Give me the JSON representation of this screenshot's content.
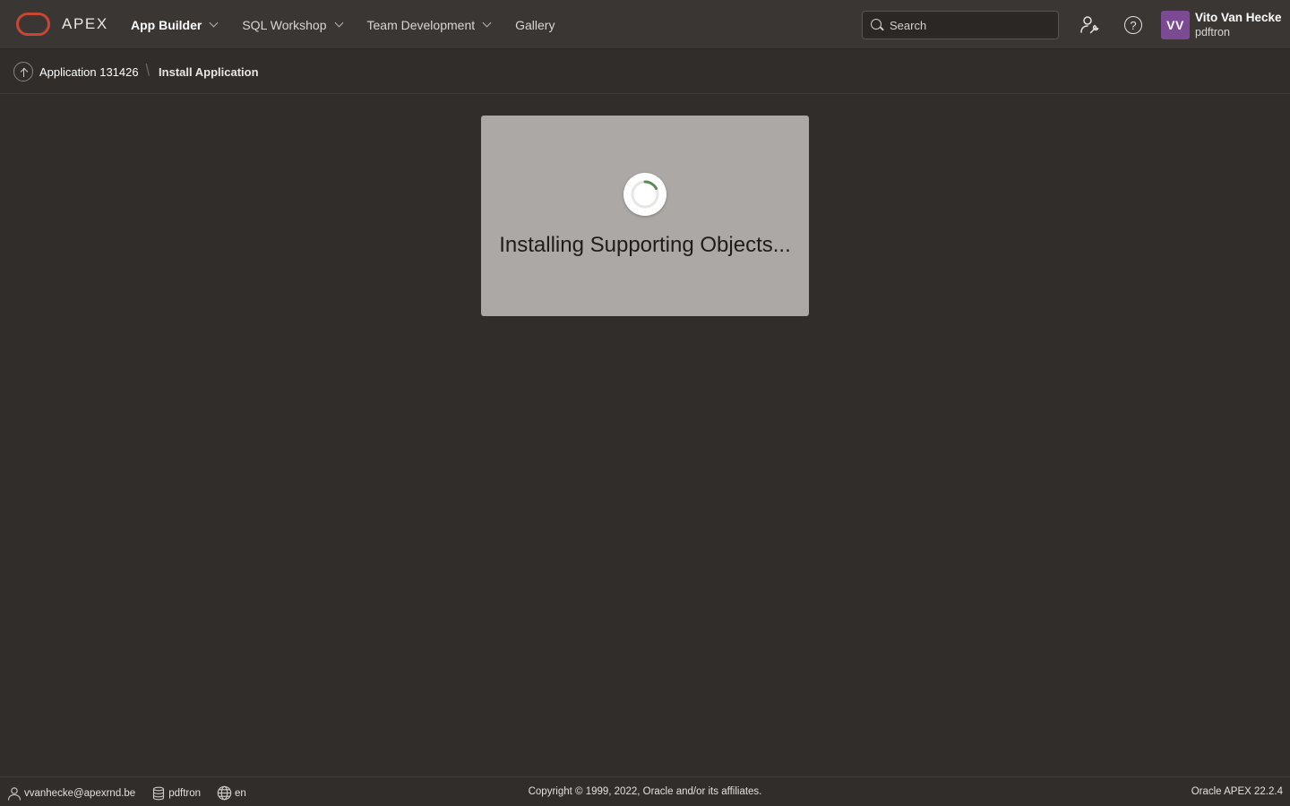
{
  "header": {
    "logo_text": "APEX",
    "nav": [
      {
        "label": "App Builder",
        "has_menu": true,
        "active": true
      },
      {
        "label": "SQL Workshop",
        "has_menu": true,
        "active": false
      },
      {
        "label": "Team Development",
        "has_menu": true,
        "active": false
      },
      {
        "label": "Gallery",
        "has_menu": false,
        "active": false
      }
    ],
    "search": {
      "placeholder": "Search",
      "value": ""
    },
    "help_glyph": "?",
    "user": {
      "initials": "VV",
      "name": "Vito Van Hecke",
      "workspace": "pdftron"
    }
  },
  "breadcrumb": {
    "parent": "Application 131426",
    "separator": "\\",
    "current": "Install Application"
  },
  "dialog": {
    "message": "Installing Supporting Objects..."
  },
  "footer": {
    "user_email": "vvanhecke@apexrnd.be",
    "workspace": "pdftron",
    "language": "en",
    "copyright": "Copyright © 1999, 2022, Oracle and/or its affiliates.",
    "version": "Oracle APEX 22.2.4"
  },
  "colors": {
    "background": "#312d2a",
    "header": "#3a3633",
    "brand_red": "#c74634",
    "avatar": "#7b4a93",
    "dialog": "#aca8a6",
    "spinner": "#5a8a58"
  },
  "icons": {
    "logo": "oracle-ring-logo",
    "search": "search-icon",
    "admin": "user-wrench-icon",
    "help": "help-icon",
    "up": "arrow-up-icon",
    "spinner": "spinner-icon",
    "footer_user": "user-icon",
    "footer_db": "database-icon",
    "footer_lang": "globe-icon"
  }
}
